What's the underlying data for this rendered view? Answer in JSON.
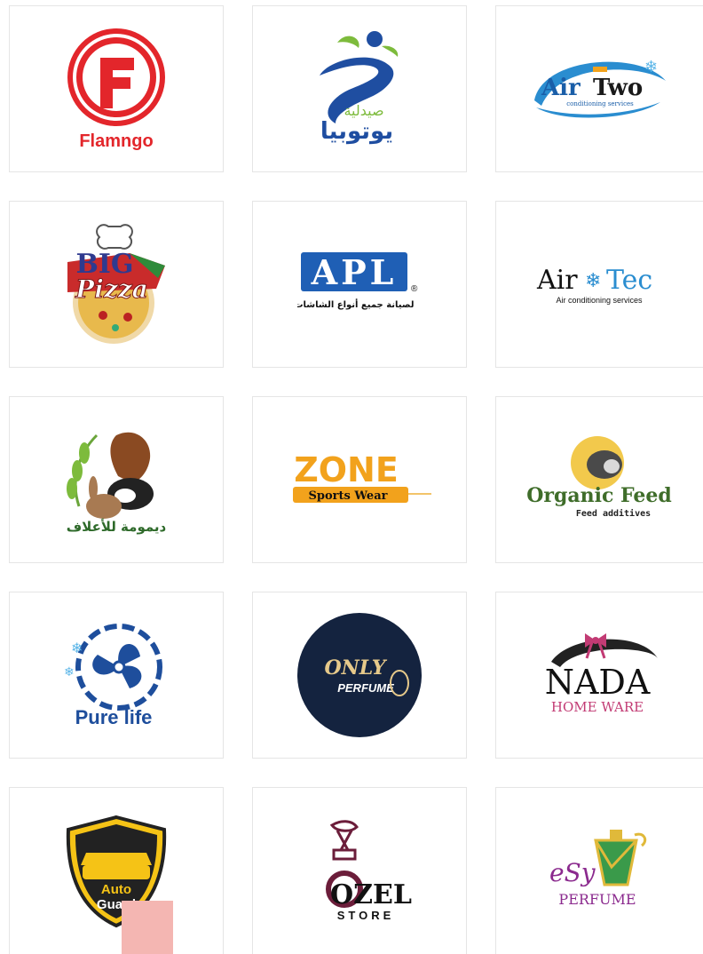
{
  "logos": {
    "flamngo": {
      "name": "Flamngo"
    },
    "utopia": {
      "top": "صيدلية",
      "bottom": "يوتوبيا"
    },
    "airtwo": {
      "name_a": "Air",
      "name_b": "Two",
      "tagline": "conditioning services"
    },
    "bigpizza": {
      "top": "BIG",
      "name": "Pizza"
    },
    "apl": {
      "name": "APL",
      "reg": "®",
      "tagline": "لصيانة جميع أنواع الشاشات"
    },
    "airtec": {
      "name_a": "Air",
      "name_b": "Tec",
      "tagline": "Air conditioning services"
    },
    "dimoma": {
      "name": "ديمومة للأعلاف"
    },
    "zone": {
      "name": "ZONE",
      "tagline": "Sports Wear"
    },
    "organic": {
      "name": "Organic Feed",
      "tagline": "Feed additives"
    },
    "purelife": {
      "name": "Pure life"
    },
    "onlyperfume": {
      "name_a": "ONLY",
      "name_b": "PERFUME"
    },
    "nada": {
      "name": "NADA",
      "tagline": "HOME WARE"
    },
    "autoguard": {
      "name_a": "Auto",
      "name_b": "Guard"
    },
    "ozel": {
      "name": "OZEL",
      "tagline": "STORE"
    },
    "esyperfume": {
      "name_a": "eSy",
      "name_b": "PERFUME"
    }
  },
  "colors": {
    "flamngo_red": "#e3262b",
    "utopia_blue": "#1f4ea1",
    "utopia_green": "#7dbb3c",
    "apl_blue": "#1f5fb5",
    "zone_orange": "#f2a21c",
    "organic_green": "#3f6d2a",
    "purelife_blue": "#1e4e9c",
    "onlyperfume_navy": "#14233f",
    "nada_pink": "#c23b74",
    "autoguard_yellow": "#f5c316",
    "ozel_maroon": "#6b1d3a",
    "esy_purple": "#8b2a8e",
    "scroll_button": "#f4b6b2"
  }
}
